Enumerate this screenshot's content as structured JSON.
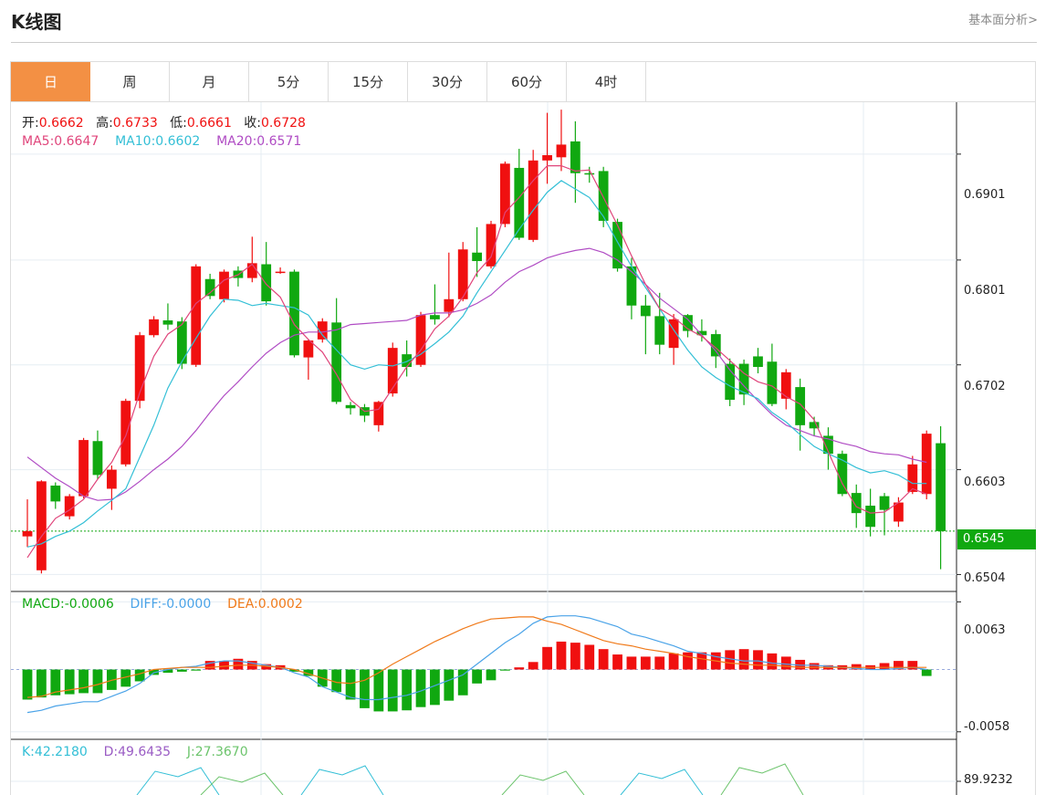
{
  "header": {
    "title": "K线图",
    "more_link": "基本面分析>"
  },
  "tabs": [
    {
      "label": "日",
      "active": true
    },
    {
      "label": "周"
    },
    {
      "label": "月"
    },
    {
      "label": "5分"
    },
    {
      "label": "15分"
    },
    {
      "label": "30分"
    },
    {
      "label": "60分"
    },
    {
      "label": "4时"
    }
  ],
  "ohlc": {
    "open_label": "开:",
    "open": "0.6662",
    "high_label": "高:",
    "high": "0.6733",
    "low_label": "低:",
    "low": "0.6661",
    "close_label": "收:",
    "close": "0.6728"
  },
  "ma": {
    "ma5_label": "MA5:",
    "ma5": "0.6647",
    "ma10_label": "MA10:",
    "ma10": "0.6602",
    "ma20_label": "MA20:",
    "ma20": "0.6571"
  },
  "macd_legend": {
    "macd_label": "MACD:",
    "macd": "-0.0006",
    "diff_label": "DIFF:",
    "diff": "-0.0000",
    "dea_label": "DEA:",
    "dea": "0.0002"
  },
  "kdj_legend": {
    "k_label": "K:",
    "k": "42.2180",
    "d_label": "D:",
    "d": "49.6435",
    "j_label": "J:",
    "j": "27.3670"
  },
  "colors": {
    "up": "#f01010",
    "down": "#10a810",
    "ma5": "#e0457b",
    "ma10": "#33bfd6",
    "ma20": "#b04cc4",
    "diff": "#4aa3e8",
    "dea": "#f07a1a",
    "k": "#33bfd6",
    "d": "#9a5cc4",
    "j": "#6cc46c",
    "accent": "#f39044"
  },
  "chart_data": {
    "type": "candlestick",
    "price_ticks": [
      "0.6901",
      "0.6801",
      "0.6702",
      "0.6603",
      "0.6504"
    ],
    "last_price": "0.6545",
    "macd_ticks": [
      "0.0063",
      "-0.0058"
    ],
    "kdj_ticks": [
      "89.9232"
    ],
    "ylim": [
      0.6488,
      0.695
    ],
    "candles": [
      [
        0.654,
        0.6545,
        0.653,
        0.6575
      ],
      [
        0.6508,
        0.6592,
        0.6505,
        0.6593
      ],
      [
        0.6588,
        0.6573,
        0.6566,
        0.6591
      ],
      [
        0.6559,
        0.6578,
        0.6556,
        0.658
      ],
      [
        0.6578,
        0.6631,
        0.6576,
        0.6633
      ],
      [
        0.663,
        0.6598,
        0.6594,
        0.664
      ],
      [
        0.6585,
        0.6603,
        0.6565,
        0.6607
      ],
      [
        0.6608,
        0.6668,
        0.6606,
        0.667
      ],
      [
        0.6668,
        0.673,
        0.6661,
        0.6733
      ],
      [
        0.673,
        0.6745,
        0.6728,
        0.6748
      ],
      [
        0.6744,
        0.674,
        0.6735,
        0.676
      ],
      [
        0.6743,
        0.6703,
        0.6698,
        0.6747
      ],
      [
        0.6702,
        0.6795,
        0.67,
        0.6797
      ],
      [
        0.6783,
        0.6767,
        0.6764,
        0.6788
      ],
      [
        0.6764,
        0.679,
        0.6761,
        0.6792
      ],
      [
        0.6791,
        0.6784,
        0.6776,
        0.6795
      ],
      [
        0.6784,
        0.6798,
        0.678,
        0.6823
      ],
      [
        0.6797,
        0.6762,
        0.6758,
        0.6818
      ],
      [
        0.6789,
        0.679,
        0.6788,
        0.6794
      ],
      [
        0.679,
        0.6711,
        0.6709,
        0.6792
      ],
      [
        0.6709,
        0.6725,
        0.6688,
        0.6726
      ],
      [
        0.6726,
        0.6743,
        0.6723,
        0.6746
      ],
      [
        0.6742,
        0.6667,
        0.6665,
        0.6765
      ],
      [
        0.6664,
        0.6661,
        0.6655,
        0.6667
      ],
      [
        0.6662,
        0.6654,
        0.6648,
        0.6665
      ],
      [
        0.6645,
        0.6667,
        0.6639,
        0.6668
      ],
      [
        0.6675,
        0.6718,
        0.6672,
        0.6723
      ],
      [
        0.6712,
        0.67,
        0.6691,
        0.6725
      ],
      [
        0.6702,
        0.6749,
        0.67,
        0.6752
      ],
      [
        0.6749,
        0.6745,
        0.674,
        0.6778
      ],
      [
        0.6752,
        0.6764,
        0.6747,
        0.6808
      ],
      [
        0.6764,
        0.6811,
        0.6762,
        0.6818
      ],
      [
        0.6808,
        0.68,
        0.6785,
        0.6832
      ],
      [
        0.6795,
        0.6835,
        0.6793,
        0.6838
      ],
      [
        0.6835,
        0.6892,
        0.6832,
        0.6894
      ],
      [
        0.6888,
        0.6822,
        0.682,
        0.6906
      ],
      [
        0.682,
        0.6895,
        0.6818,
        0.6905
      ],
      [
        0.6895,
        0.69,
        0.6873,
        0.694
      ],
      [
        0.6898,
        0.691,
        0.6885,
        0.6943
      ],
      [
        0.6913,
        0.6883,
        0.6855,
        0.6932
      ],
      [
        0.6883,
        0.6882,
        0.6874,
        0.6889
      ],
      [
        0.6885,
        0.6838,
        0.6832,
        0.6889
      ],
      [
        0.6837,
        0.6793,
        0.679,
        0.684
      ],
      [
        0.6795,
        0.6758,
        0.6745,
        0.6803
      ],
      [
        0.6758,
        0.6748,
        0.6712,
        0.6768
      ],
      [
        0.6748,
        0.6721,
        0.6712,
        0.677
      ],
      [
        0.6718,
        0.6745,
        0.6702,
        0.675
      ],
      [
        0.6749,
        0.6734,
        0.6728,
        0.675
      ],
      [
        0.6734,
        0.673,
        0.6724,
        0.6745
      ],
      [
        0.6731,
        0.671,
        0.6699,
        0.6735
      ],
      [
        0.6703,
        0.6669,
        0.6663,
        0.6708
      ],
      [
        0.6703,
        0.6674,
        0.6664,
        0.6707
      ],
      [
        0.671,
        0.67,
        0.6694,
        0.6718
      ],
      [
        0.6705,
        0.6665,
        0.6663,
        0.6722
      ],
      [
        0.667,
        0.6695,
        0.666,
        0.6698
      ],
      [
        0.6681,
        0.6645,
        0.6621,
        0.6689
      ],
      [
        0.6648,
        0.6642,
        0.6635,
        0.6653
      ],
      [
        0.6635,
        0.6618,
        0.6603,
        0.6643
      ],
      [
        0.6618,
        0.658,
        0.6578,
        0.6621
      ],
      [
        0.6581,
        0.6562,
        0.6548,
        0.6589
      ],
      [
        0.6569,
        0.6549,
        0.654,
        0.6585
      ],
      [
        0.6578,
        0.6565,
        0.6541,
        0.6581
      ],
      [
        0.6554,
        0.6572,
        0.6549,
        0.6577
      ],
      [
        0.6582,
        0.6608,
        0.658,
        0.6616
      ],
      [
        0.658,
        0.6637,
        0.6575,
        0.664
      ],
      [
        0.6628,
        0.6545,
        0.6509,
        0.6644
      ]
    ],
    "ma5": [
      0.652,
      0.654,
      0.6557,
      0.6565,
      0.6575,
      0.6594,
      0.661,
      0.6635,
      0.6676,
      0.671,
      0.6731,
      0.674,
      0.676,
      0.677,
      0.6782,
      0.6787,
      0.6797,
      0.6778,
      0.6766,
      0.674,
      0.6726,
      0.6714,
      0.6693,
      0.6669,
      0.6658,
      0.666,
      0.668,
      0.67,
      0.6716,
      0.6736,
      0.6748,
      0.6766,
      0.6789,
      0.6804,
      0.6846,
      0.686,
      0.6876,
      0.689,
      0.689,
      0.6885,
      0.6886,
      0.686,
      0.6834,
      0.6805,
      0.6778,
      0.6755,
      0.6747,
      0.6736,
      0.6729,
      0.6718,
      0.6706,
      0.6694,
      0.6686,
      0.6682,
      0.6672,
      0.6665,
      0.665,
      0.662,
      0.659,
      0.6568,
      0.6562,
      0.6563,
      0.6572,
      0.6585,
      0.658
    ],
    "ma10": [
      0.653,
      0.6533,
      0.654,
      0.6545,
      0.6553,
      0.6564,
      0.6574,
      0.6585,
      0.6615,
      0.6645,
      0.668,
      0.6705,
      0.6727,
      0.6748,
      0.6764,
      0.6763,
      0.6758,
      0.676,
      0.6758,
      0.6756,
      0.6749,
      0.673,
      0.6716,
      0.6702,
      0.6698,
      0.6702,
      0.6701,
      0.6705,
      0.6712,
      0.6722,
      0.6733,
      0.6748,
      0.677,
      0.679,
      0.681,
      0.683,
      0.6848,
      0.6865,
      0.6876,
      0.6868,
      0.686,
      0.6842,
      0.6818,
      0.6795,
      0.6775,
      0.6755,
      0.6735,
      0.6716,
      0.67,
      0.669,
      0.6682,
      0.6676,
      0.667,
      0.6657,
      0.6648,
      0.6636,
      0.6625,
      0.6618,
      0.6612,
      0.6605,
      0.66,
      0.6602,
      0.6598,
      0.659,
      0.659
    ],
    "ma20": [
      0.6615,
      0.6605,
      0.6595,
      0.6587,
      0.6578,
      0.6574,
      0.6575,
      0.6582,
      0.6592,
      0.6603,
      0.6613,
      0.6625,
      0.664,
      0.6657,
      0.6673,
      0.6686,
      0.67,
      0.6713,
      0.6723,
      0.673,
      0.6733,
      0.6733,
      0.6735,
      0.674,
      0.6741,
      0.6742,
      0.6743,
      0.6744,
      0.6749,
      0.6751,
      0.6751,
      0.6754,
      0.676,
      0.6768,
      0.678,
      0.679,
      0.6796,
      0.6803,
      0.6807,
      0.681,
      0.6812,
      0.6808,
      0.6801,
      0.679,
      0.6778,
      0.6765,
      0.6755,
      0.6745,
      0.673,
      0.6715,
      0.6697,
      0.6682,
      0.6668,
      0.6655,
      0.6645,
      0.664,
      0.6635,
      0.6632,
      0.6628,
      0.6625,
      0.662,
      0.6618,
      0.6617,
      0.6613,
      0.661
    ],
    "macd_ylim": [
      -0.0065,
      0.0071
    ],
    "macd_hist": [
      -0.0028,
      -0.0026,
      -0.0024,
      -0.0023,
      -0.0022,
      -0.0022,
      -0.0019,
      -0.0016,
      -0.0011,
      -0.0005,
      -0.0003,
      -0.0002,
      -0.0001,
      0.0008,
      0.0008,
      0.001,
      0.0008,
      0.0005,
      0.0004,
      -0.0002,
      -0.0006,
      -0.0016,
      -0.0021,
      -0.0028,
      -0.0036,
      -0.0039,
      -0.0039,
      -0.0038,
      -0.0035,
      -0.0033,
      -0.0029,
      -0.0024,
      -0.0013,
      -0.001,
      -0.0001,
      0.0002,
      0.0007,
      0.0021,
      0.0026,
      0.0025,
      0.0023,
      0.0019,
      0.0014,
      0.0012,
      0.0012,
      0.0012,
      0.0015,
      0.0016,
      0.0016,
      0.0016,
      0.0018,
      0.0019,
      0.0018,
      0.0015,
      0.0012,
      0.0009,
      0.0006,
      0.0004,
      0.0004,
      0.0005,
      0.0004,
      0.0006,
      0.0008,
      0.0008,
      -0.0006
    ],
    "diff": [
      -0.004,
      -0.0038,
      -0.0034,
      -0.0032,
      -0.003,
      -0.003,
      -0.0025,
      -0.002,
      -0.0013,
      -0.0003,
      0.0,
      0.0002,
      0.0003,
      0.0006,
      0.0008,
      0.0008,
      0.0006,
      0.0004,
      0.0002,
      -0.0003,
      -0.0007,
      -0.0016,
      -0.0021,
      -0.0026,
      -0.0028,
      -0.0028,
      -0.0026,
      -0.0024,
      -0.002,
      -0.0015,
      -0.001,
      -0.0005,
      0.0005,
      0.0015,
      0.0025,
      0.0033,
      0.0043,
      0.0049,
      0.005,
      0.005,
      0.0048,
      0.0044,
      0.004,
      0.0033,
      0.003,
      0.0026,
      0.0022,
      0.0017,
      0.0015,
      0.0012,
      0.001,
      0.0008,
      0.0008,
      0.0006,
      0.0005,
      0.0004,
      0.0004,
      0.0003,
      0.0002,
      0.0001,
      0.0,
      0.0,
      0.0001,
      0.0002,
      -0.0
    ],
    "dea": [
      -0.0026,
      -0.0025,
      -0.0021,
      -0.0019,
      -0.0017,
      -0.0014,
      -0.001,
      -0.0007,
      -0.0004,
      -0.0,
      0.0001,
      0.0002,
      0.0002,
      0.0002,
      0.0003,
      0.0004,
      0.0004,
      0.0003,
      0.0002,
      -0.0,
      -0.0004,
      -0.0008,
      -0.0012,
      -0.0013,
      -0.001,
      -0.0003,
      0.0005,
      0.0012,
      0.0019,
      0.0026,
      0.0032,
      0.0038,
      0.0043,
      0.0047,
      0.0048,
      0.0049,
      0.0049,
      0.0045,
      0.0042,
      0.0037,
      0.0032,
      0.0027,
      0.0024,
      0.0022,
      0.0019,
      0.0017,
      0.0015,
      0.0012,
      0.001,
      0.0008,
      0.0006,
      0.0005,
      0.0004,
      0.0004,
      0.0003,
      0.0002,
      0.0002,
      0.0002,
      0.0002,
      0.0002,
      0.0002,
      0.0002,
      0.0002,
      0.0002,
      0.0002
    ],
    "kdj_ylim": [
      0,
      100
    ],
    "k_line": [
      null,
      null,
      null,
      null,
      null,
      null,
      null,
      null,
      null,
      null,
      null,
      null,
      null,
      null,
      null,
      null,
      null,
      null,
      null,
      null,
      null,
      null,
      null,
      null,
      null,
      null,
      null,
      null,
      null,
      null,
      null,
      null,
      null,
      null,
      null,
      null,
      null,
      null,
      null,
      null,
      null,
      null,
      null,
      null,
      null,
      null,
      null,
      null,
      null,
      null,
      null,
      null,
      null,
      null,
      null,
      null,
      null,
      null,
      null,
      null,
      null,
      null,
      null,
      null,
      null
    ]
  }
}
